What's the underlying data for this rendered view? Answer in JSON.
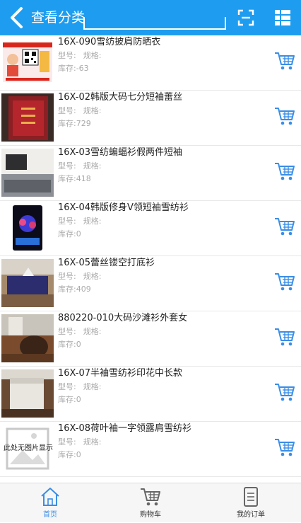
{
  "header": {
    "title": "查看分类",
    "search_value": ""
  },
  "products": [
    {
      "name": "16X-090雪纺披肩防晒衣",
      "model_label": "型号:",
      "spec_label": "规格:",
      "stock": "库存:-63"
    },
    {
      "name": "16X-02韩版大码七分短袖蕾丝",
      "model_label": "型号:",
      "spec_label": "规格:",
      "stock": "库存:729"
    },
    {
      "name": "16X-03雪纺蝙蝠衫假两件短袖",
      "model_label": "型号:",
      "spec_label": "规格:",
      "stock": "库存:418"
    },
    {
      "name": "16X-04韩版修身V领短袖雪纺衫",
      "model_label": "型号:",
      "spec_label": "规格:",
      "stock": "库存:0"
    },
    {
      "name": "16X-05蕾丝镂空打底衫",
      "model_label": "型号:",
      "spec_label": "规格:",
      "stock": "库存:409"
    },
    {
      "name": "880220-010大码沙滩衫外套女",
      "model_label": "型号:",
      "spec_label": "规格:",
      "stock": "库存:0"
    },
    {
      "name": "16X-07半袖雪纺衫印花中长款",
      "model_label": "型号:",
      "spec_label": "规格:",
      "stock": "库存:0"
    },
    {
      "name": "16X-08荷叶袖一字领露肩雪纺衫",
      "model_label": "型号:",
      "spec_label": "规格:",
      "stock": "库存:0",
      "no_image_label": "此处无图片显示"
    }
  ],
  "tabs": [
    {
      "label": "首页",
      "icon": "home-icon",
      "active": true
    },
    {
      "label": "购物车",
      "icon": "cart-icon",
      "active": false
    },
    {
      "label": "我的订单",
      "icon": "orders-icon",
      "active": false
    }
  ],
  "colors": {
    "header_bg": "#1e9df0",
    "cart_icon": "#3a8ee6",
    "active_tab": "#3a8ee6"
  }
}
